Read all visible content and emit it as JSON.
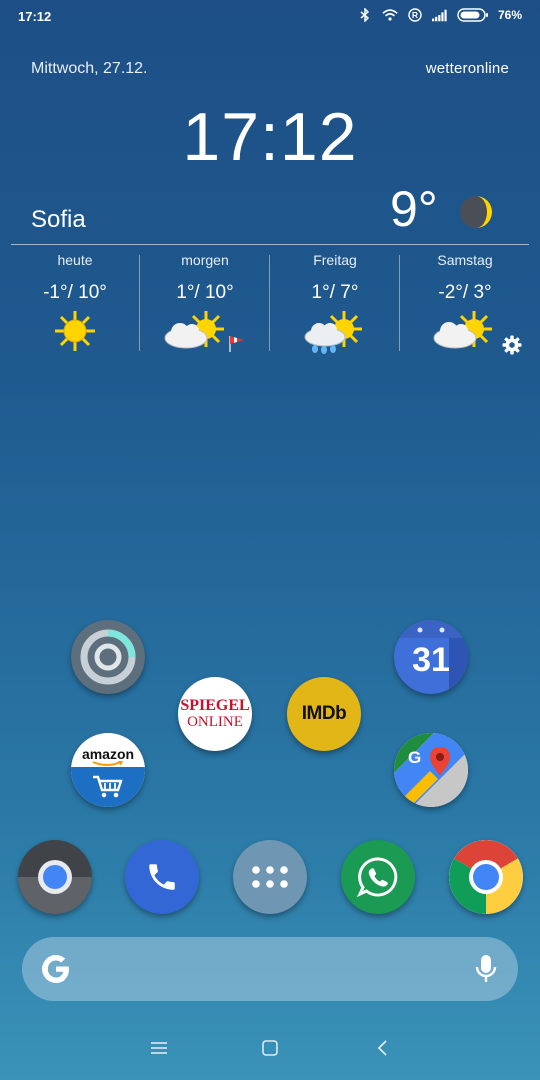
{
  "status_bar": {
    "time": "17:12",
    "battery_percent": "76%",
    "icons": [
      "bluetooth-icon",
      "wifi-icon",
      "registered-icon",
      "signal-icon",
      "battery-icon"
    ]
  },
  "weather_widget": {
    "date": "Mittwoch, 27.12.",
    "brand": "wetteronline",
    "clock": "17:12",
    "city": "Sofia",
    "current_temp": "9°",
    "current_icon": "moon-icon",
    "forecast": [
      {
        "day": "heute",
        "temp": "-1°/ 10°",
        "icon": "sun-icon"
      },
      {
        "day": "morgen",
        "temp": "1°/ 10°",
        "icon": "sun-cloud-icon"
      },
      {
        "day": "Freitag",
        "temp": "1°/ 7°",
        "icon": "sun-cloud-rain-icon"
      },
      {
        "day": "Samstag",
        "temp": "-2°/ 3°",
        "icon": "sun-cloud-icon"
      }
    ]
  },
  "home_apps": {
    "spiegel_line1": "SPIEGEL",
    "spiegel_line2": "ONLINE",
    "imdb": "IMDb",
    "amazon": "amazon",
    "calendar_day": "31"
  },
  "dock": [
    "camera",
    "phone",
    "app-drawer",
    "whatsapp",
    "chrome"
  ],
  "search": {
    "icons": [
      "google-icon",
      "microphone-icon"
    ]
  },
  "colors": {
    "accent_sun": "#ffd400",
    "spiegel_red": "#c8102e",
    "imdb_yellow": "#e2b616"
  }
}
